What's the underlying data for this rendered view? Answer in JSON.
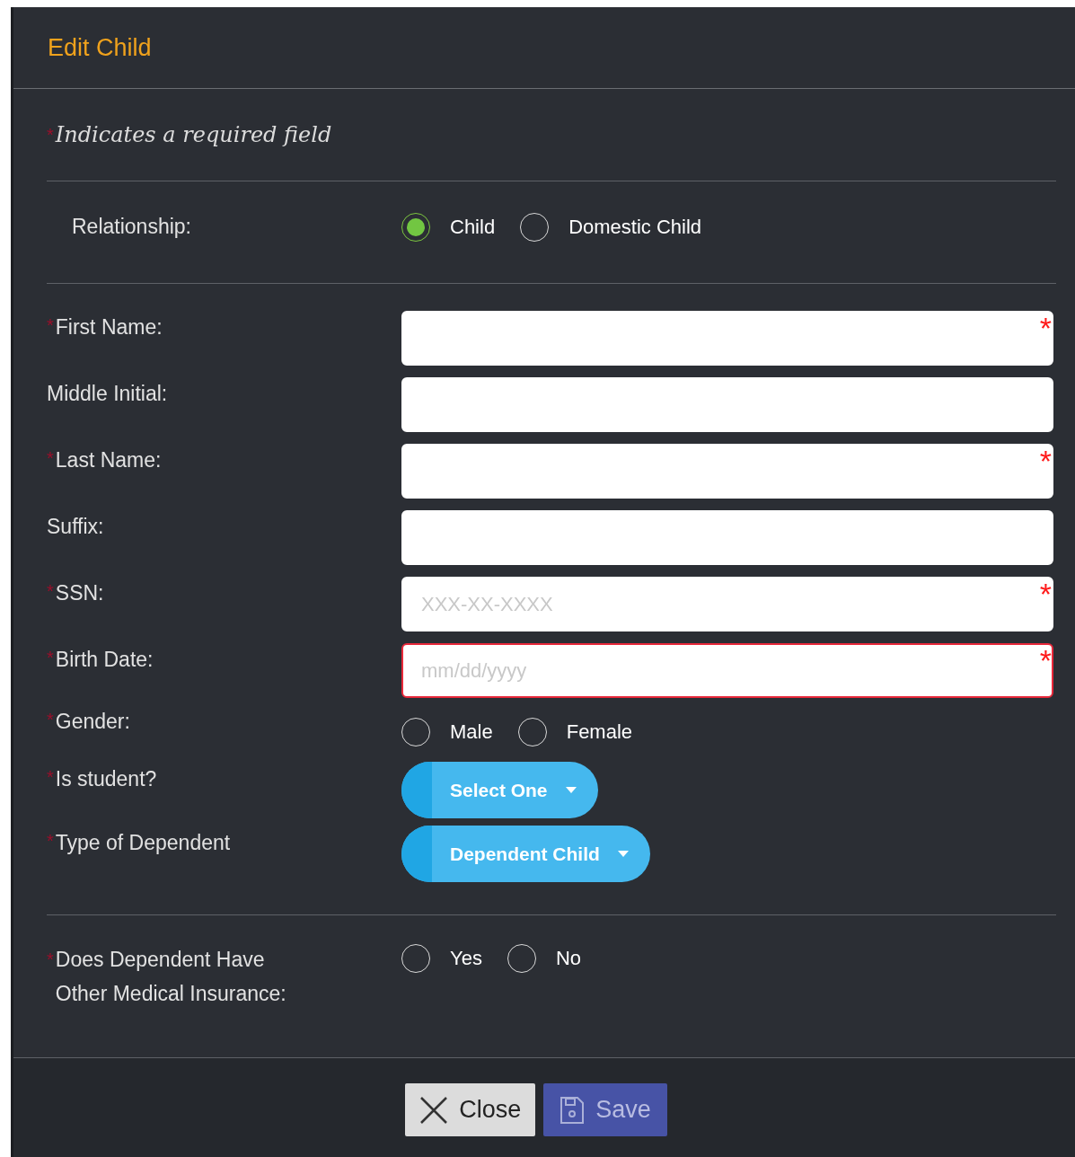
{
  "dialog": {
    "title": "Edit Child"
  },
  "required_note": {
    "mark": "*",
    "text": "Indicates a required field"
  },
  "relationship": {
    "label": "Relationship:",
    "options": [
      {
        "label": "Child",
        "selected": true
      },
      {
        "label": "Domestic Child",
        "selected": false
      }
    ]
  },
  "fields": [
    {
      "kind": "text",
      "label": "First Name:",
      "required_mark": "*",
      "field_mark": "*",
      "invalid": false
    },
    {
      "kind": "text",
      "label": "Middle Initial:",
      "invalid": false
    },
    {
      "kind": "text",
      "label": "Last Name:",
      "required_mark": "*",
      "field_mark": "*",
      "invalid": false
    },
    {
      "kind": "text",
      "label": "Suffix:",
      "invalid": false
    },
    {
      "kind": "text",
      "label": "SSN:",
      "required_mark": "*",
      "field_mark": "*",
      "placeholder": "XXX-XX-XXXX",
      "invalid": false
    },
    {
      "kind": "text",
      "label": "Birth Date:",
      "required_mark": "*",
      "field_mark": "*",
      "placeholder": "mm/dd/yyyy",
      "invalid": true
    },
    {
      "kind": "radio",
      "label": "Gender:",
      "required_mark": "*",
      "options": [
        {
          "label": "Male",
          "selected": false
        },
        {
          "label": "Female",
          "selected": false
        }
      ]
    },
    {
      "kind": "select",
      "label": "Is student?",
      "required_mark": "*",
      "value": "Select One"
    },
    {
      "kind": "select",
      "label": "Type of Dependent",
      "required_mark": "*",
      "value": "Dependent Child"
    }
  ],
  "insurance": {
    "label": "Does Dependent Have\nOther Medical Insurance:",
    "required_mark": "*",
    "options": [
      {
        "label": "Yes",
        "selected": false
      },
      {
        "label": "No",
        "selected": false
      }
    ]
  },
  "buttons": [
    {
      "kind": "close",
      "label": "Close"
    },
    {
      "kind": "save",
      "label": "Save"
    }
  ]
}
